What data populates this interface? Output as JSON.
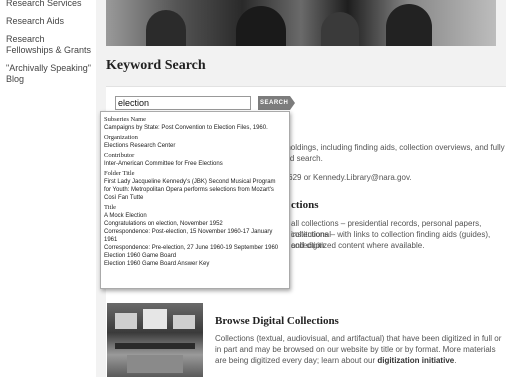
{
  "sidebar": {
    "items": [
      {
        "label": "Research Services"
      },
      {
        "label": "Research Aids"
      },
      {
        "label": "Research Fellowships & Grants"
      },
      {
        "label": "\"Archivally Speaking\" Blog"
      }
    ]
  },
  "page": {
    "title": "Keyword Search"
  },
  "search": {
    "value": "election",
    "button_label": "SEARCH"
  },
  "background_text": {
    "line1": "ur holdings, including finding aids, collection overviews, and fully or",
    "line2": "nced search.",
    "line3": "4.1629 or Kennedy.Library@nara.gov.",
    "heading": "ctions",
    "line4": "all collections – presidential records, personal papers, institutional",
    "line5": "collections – with links to collection finding aids (guides), collection",
    "line6": "and digitized content where available."
  },
  "dropdown": {
    "groups": [
      {
        "title": "Subseries Name",
        "options": [
          "Campaigns by State: Post Convention to Election Files, 1960."
        ]
      },
      {
        "title": "Organization",
        "options": [
          "Elections Research Center"
        ]
      },
      {
        "title": "Contributor",
        "options": [
          "Inter-American Committee for Free Elections"
        ]
      },
      {
        "title": "Folder Title",
        "options": [
          "First Lady Jacqueline Kennedy's (JBK) Second Musical Program for Youth: Metropolitan Opera performs selections from Mozart's Così Fan Tutte"
        ]
      },
      {
        "title": "Title",
        "options": [
          "A Mock Election",
          "Congratulations on election, November 1952",
          "Correspondence: Post-election, 15 November 1960-17 January 1961",
          "Correspondence: Pre-election, 27 June 1960-19 September 1960",
          "Election 1960 Game Board",
          "Election 1960 Game Board Answer Key"
        ]
      }
    ]
  },
  "browse": {
    "title": "Browse Digital Collections",
    "desc_part1": "Collections (textual, audiovisual, and artifactual) that have been digitized in full or in part and may be browsed on our website by title or by format. More materials are being digitized every day; learn about our ",
    "desc_link": "digitization initiative",
    "desc_end": "."
  }
}
